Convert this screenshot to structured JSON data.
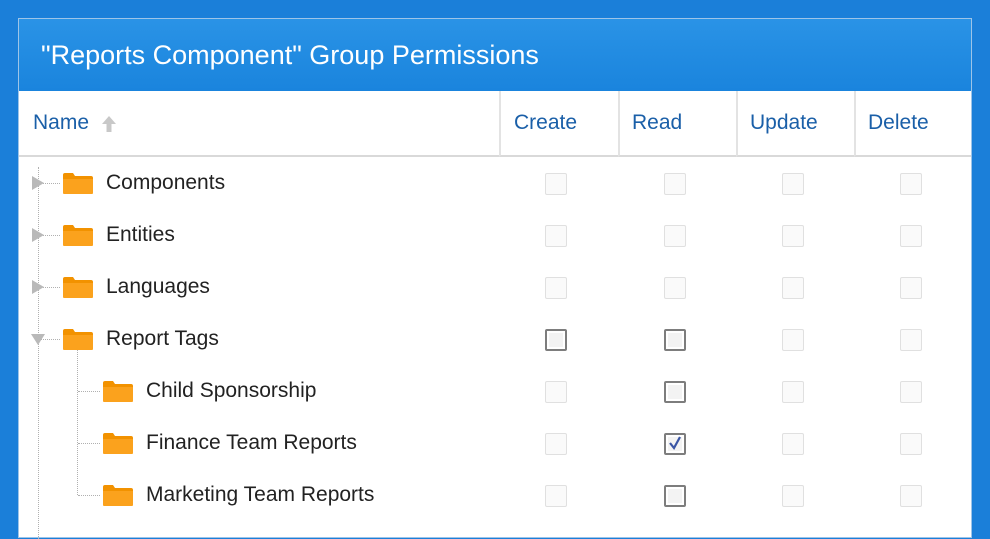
{
  "panel": {
    "title": "\"Reports Component\" Group Permissions"
  },
  "columns": {
    "name": "Name",
    "create": "Create",
    "read": "Read",
    "update": "Update",
    "delete": "Delete"
  },
  "colors": {
    "background": "#1b7fd9",
    "header_bar": "#1a84dd",
    "column_label": "#1a5fa8",
    "folder": "#fba21d"
  },
  "icons": {
    "sort": "sort-ascending-arrow-icon",
    "folder": "folder-icon",
    "collapsed": "triangle-right-icon",
    "expanded": "triangle-down-icon",
    "check": "checkmark-icon"
  },
  "rows": [
    {
      "label": "Components",
      "level": 0,
      "expander": "collapsed",
      "permissions": {
        "create": "disabled",
        "read": "disabled",
        "update": "disabled",
        "delete": "disabled"
      }
    },
    {
      "label": "Entities",
      "level": 0,
      "expander": "collapsed",
      "permissions": {
        "create": "disabled",
        "read": "disabled",
        "update": "disabled",
        "delete": "disabled"
      }
    },
    {
      "label": "Languages",
      "level": 0,
      "expander": "collapsed",
      "permissions": {
        "create": "disabled",
        "read": "disabled",
        "update": "disabled",
        "delete": "disabled"
      }
    },
    {
      "label": "Report Tags",
      "level": 0,
      "expander": "expanded",
      "permissions": {
        "create": "unchecked",
        "read": "unchecked",
        "update": "disabled",
        "delete": "disabled"
      }
    },
    {
      "label": "Child Sponsorship",
      "level": 1,
      "expander": "none",
      "permissions": {
        "create": "disabled",
        "read": "unchecked",
        "update": "disabled",
        "delete": "disabled"
      }
    },
    {
      "label": "Finance Team Reports",
      "level": 1,
      "expander": "none",
      "permissions": {
        "create": "disabled",
        "read": "checked",
        "update": "disabled",
        "delete": "disabled"
      }
    },
    {
      "label": "Marketing Team Reports",
      "level": 1,
      "expander": "none",
      "permissions": {
        "create": "disabled",
        "read": "unchecked",
        "update": "disabled",
        "delete": "disabled"
      }
    }
  ]
}
